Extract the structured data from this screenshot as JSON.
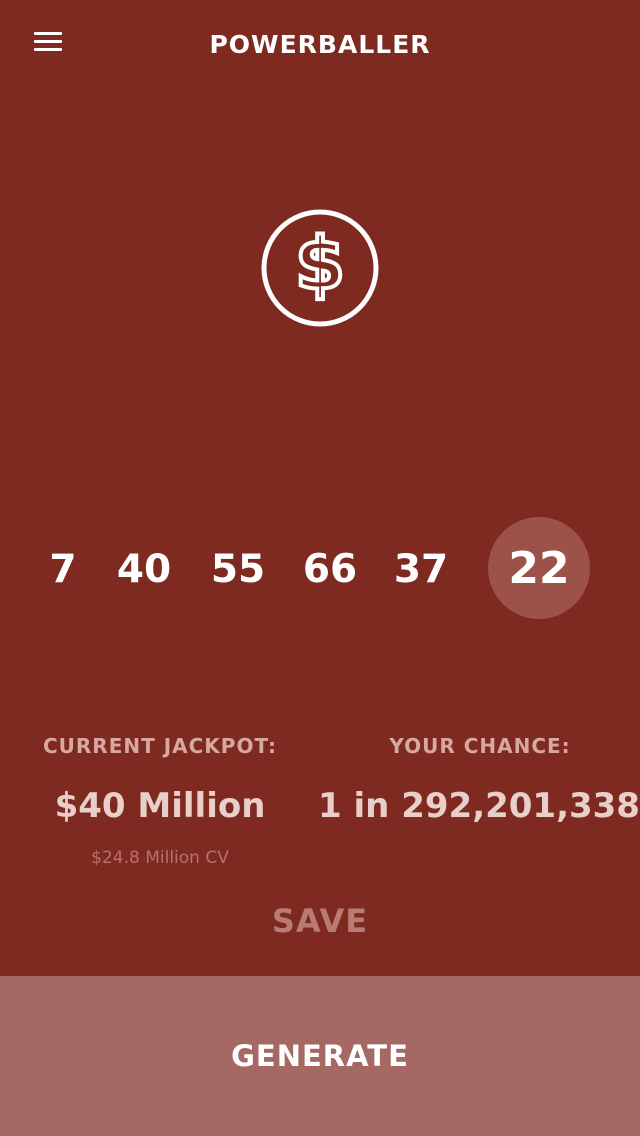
{
  "header": {
    "title": "POWERBALLER",
    "menu_icon": "hamburger-menu-icon"
  },
  "hero": {
    "icon": "dollar-circle-icon",
    "symbol": "$"
  },
  "numbers": {
    "main": [
      "7",
      "40",
      "55",
      "66",
      "37"
    ],
    "powerball": "22"
  },
  "jackpot": {
    "label": "CURRENT JACKPOT:",
    "value": "$40 Million",
    "cash_value": "$24.8 Million CV"
  },
  "chance": {
    "label": "YOUR CHANCE:",
    "value": "1 in 292,201,338"
  },
  "actions": {
    "save_label": "SAVE",
    "generate_label": "GENERATE"
  },
  "colors": {
    "background": "#7f2a21",
    "powerball_bg": "#9c5249",
    "generate_bg": "#a66862"
  }
}
